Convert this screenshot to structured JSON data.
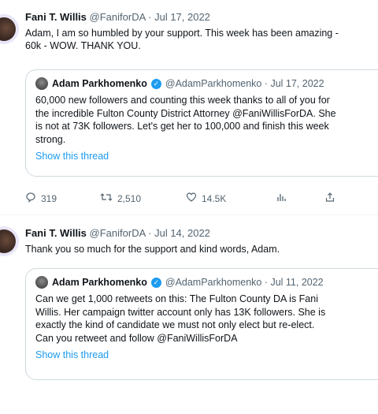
{
  "tweets": [
    {
      "name": "Fani T. Willis",
      "meta": "@FaniforDA · Jul 17, 2022",
      "text_lines": [
        "Adam, I am so humbled by your support.  This week has been amazing -",
        "60k - WOW.  THANK YOU."
      ],
      "quote": {
        "name": "Adam Parkhomenko",
        "meta": "@AdamParkhomenko · Jul 17, 2022",
        "lines": [
          "60,000 new followers and counting this week thanks to all of you for",
          "the incredible Fulton County District Attorney @FaniWillisForDA. She",
          "is not at 73K followers. Let's get her to 100,000 and finish this week",
          "strong."
        ],
        "show_thread": "Show this thread"
      },
      "actions": {
        "replies": "319",
        "retweets": "2,510",
        "likes": "14.5K"
      }
    },
    {
      "name": "Fani T. Willis",
      "meta": "@FaniforDA · Jul 14, 2022",
      "text_lines": [
        "Thank you so much for the support and kind words, Adam."
      ],
      "quote": {
        "name": "Adam Parkhomenko",
        "meta": "@AdamParkhomenko · Jul 11, 2022",
        "lines": [
          "Can we get 1,000 retweets on this: The Fulton County DA is Fani",
          "Willis. Her campaign twitter account only has 13K followers. She is",
          "exactly the kind of candidate we must not only elect but re-elect.",
          "Can you retweet and follow @FaniWillisForDA"
        ],
        "show_thread": "Show this thread"
      }
    }
  ],
  "icons": {
    "reply": "reply-icon",
    "retweet": "retweet-icon",
    "like": "heart-icon",
    "analytics": "analytics-icon",
    "share": "share-icon"
  },
  "colors": {
    "link": "#1d9bf0",
    "verified": "#1d9bf0",
    "muted": "#536471"
  }
}
